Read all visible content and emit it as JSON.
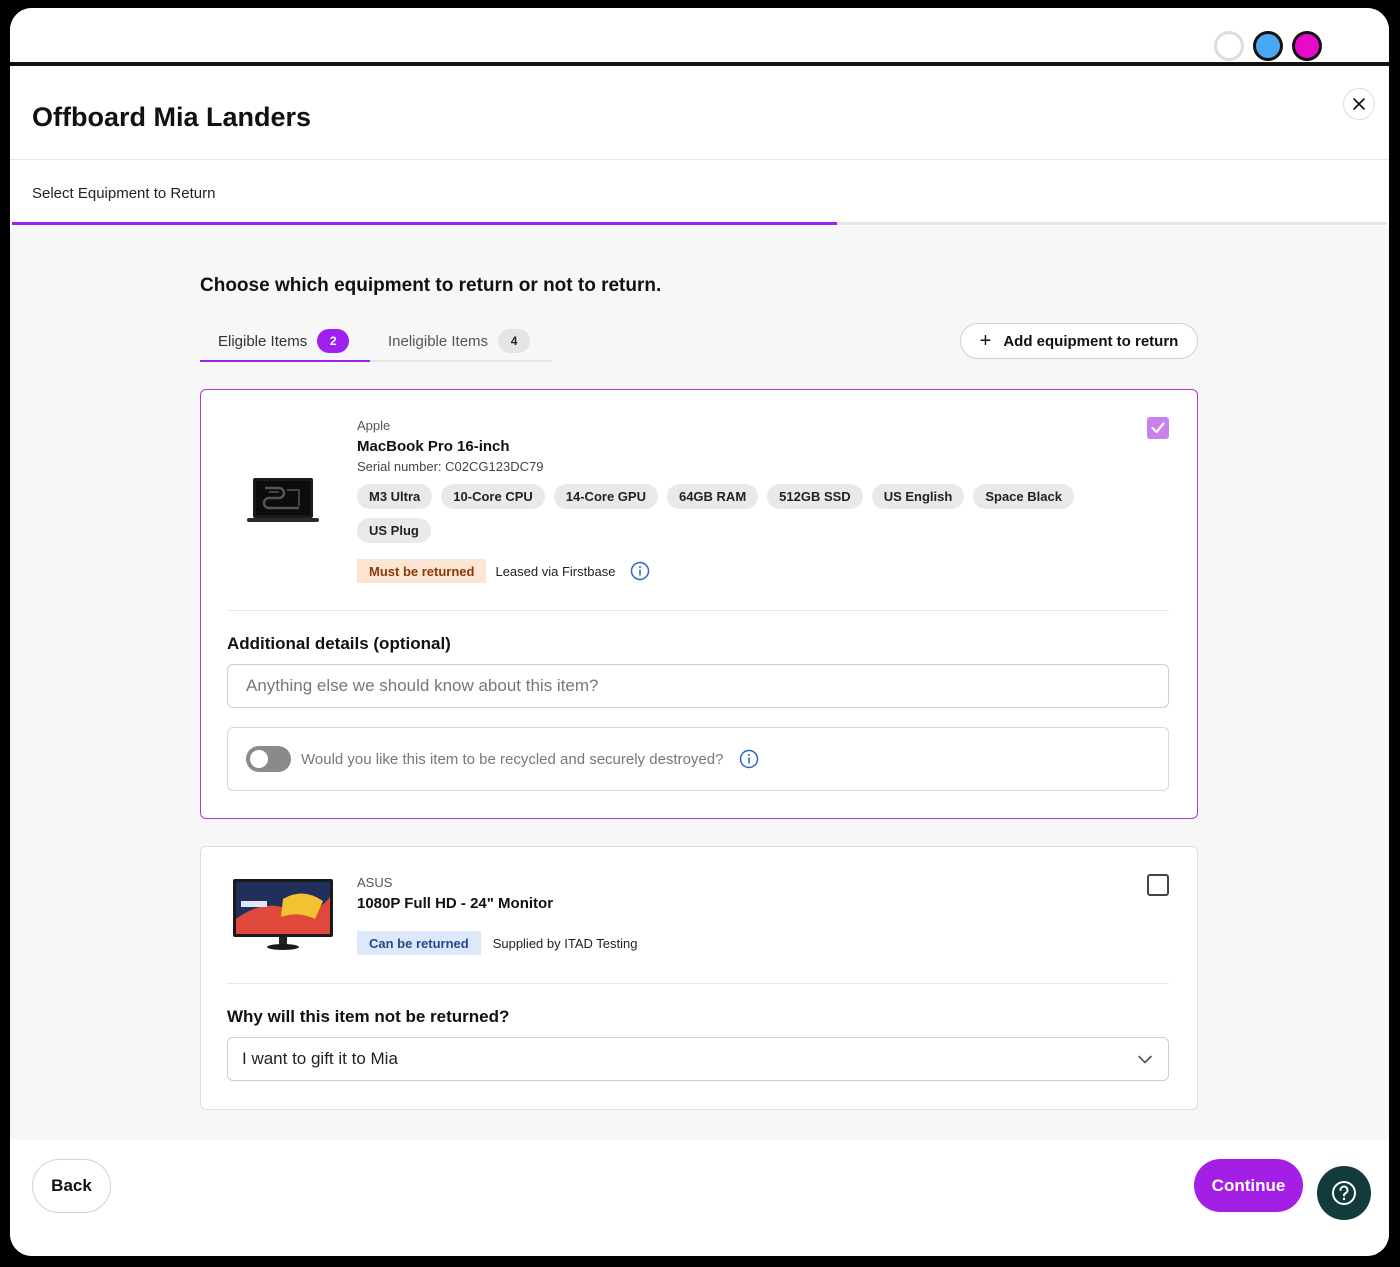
{
  "window": {
    "color_dots": [
      "#ffffff",
      "#4aa8f5",
      "#e60acb"
    ]
  },
  "header": {
    "title": "Offboard Mia Landers"
  },
  "stepper": {
    "step_label": "Select Equipment to Return",
    "progress_percent": 60
  },
  "main": {
    "heading": "Choose which equipment to return or not to return.",
    "tabs": [
      {
        "label": "Eligible Items",
        "count": "2",
        "active": true
      },
      {
        "label": "Ineligible Items",
        "count": "4",
        "active": false
      }
    ],
    "add_button_label": "Add equipment to return",
    "items": [
      {
        "brand": "Apple",
        "name": "MacBook Pro 16-inch",
        "serial": "Serial number: C02CG123DC79",
        "specs": [
          "M3 Ultra",
          "10-Core CPU",
          "14-Core GPU",
          "64GB RAM",
          "512GB SSD",
          "US English",
          "Space Black",
          "US Plug"
        ],
        "status_badge": "Must be returned",
        "source": "Leased via Firstbase",
        "checked": true,
        "details_title": "Additional details (optional)",
        "details_placeholder": "Anything else we should know about this item?",
        "recycle_question": "Would you like this item to be recycled and securely destroyed?"
      },
      {
        "brand": "ASUS",
        "name": "1080P Full HD - 24\" Monitor",
        "status_badge": "Can be returned",
        "source": "Supplied by ITAD Testing",
        "checked": false,
        "reason_title": "Why will this item not be returned?",
        "reason_value": "I want to gift it to Mia"
      }
    ]
  },
  "footer": {
    "back_label": "Back",
    "continue_label": "Continue"
  },
  "colors": {
    "accent": "#a020f0",
    "must_badge_bg": "#fde5d4",
    "can_badge_bg": "#dde9fb",
    "help_bg": "#143b3b"
  }
}
